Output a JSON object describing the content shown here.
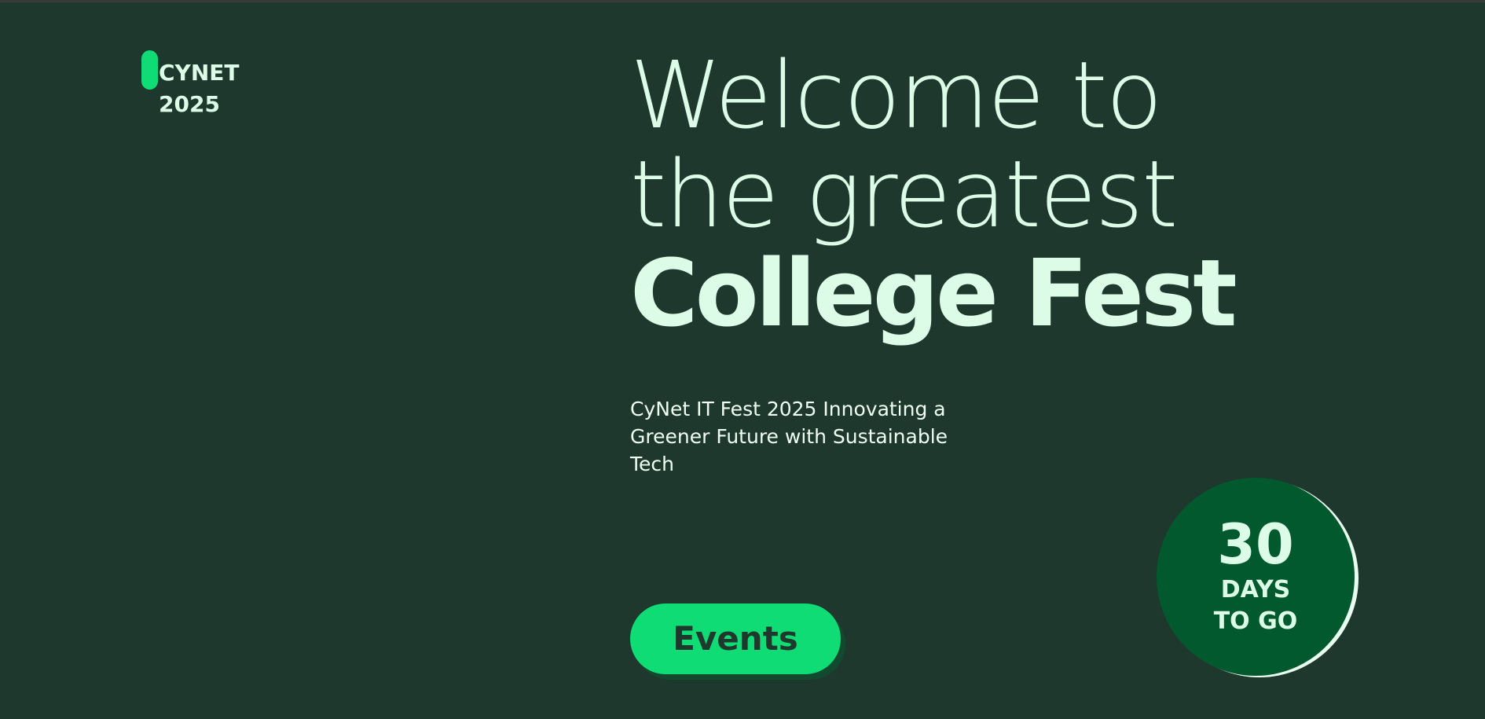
{
  "logo": {
    "line1": "CYNET",
    "line2": "2025"
  },
  "hero": {
    "line1": "Welcome to",
    "line2": "the greatest",
    "line3": "College Fest",
    "subtitle": "CyNet IT Fest 2025 Innovating a Greener Future with Sustainable Tech"
  },
  "cta": {
    "events_label": "Events"
  },
  "countdown": {
    "days": "30",
    "line1": "DAYS",
    "line2": "TO GO"
  },
  "colors": {
    "background": "#1f382d",
    "accent": "#0fdc75",
    "text": "#dcfce8",
    "countdown_bg": "#02592d"
  }
}
